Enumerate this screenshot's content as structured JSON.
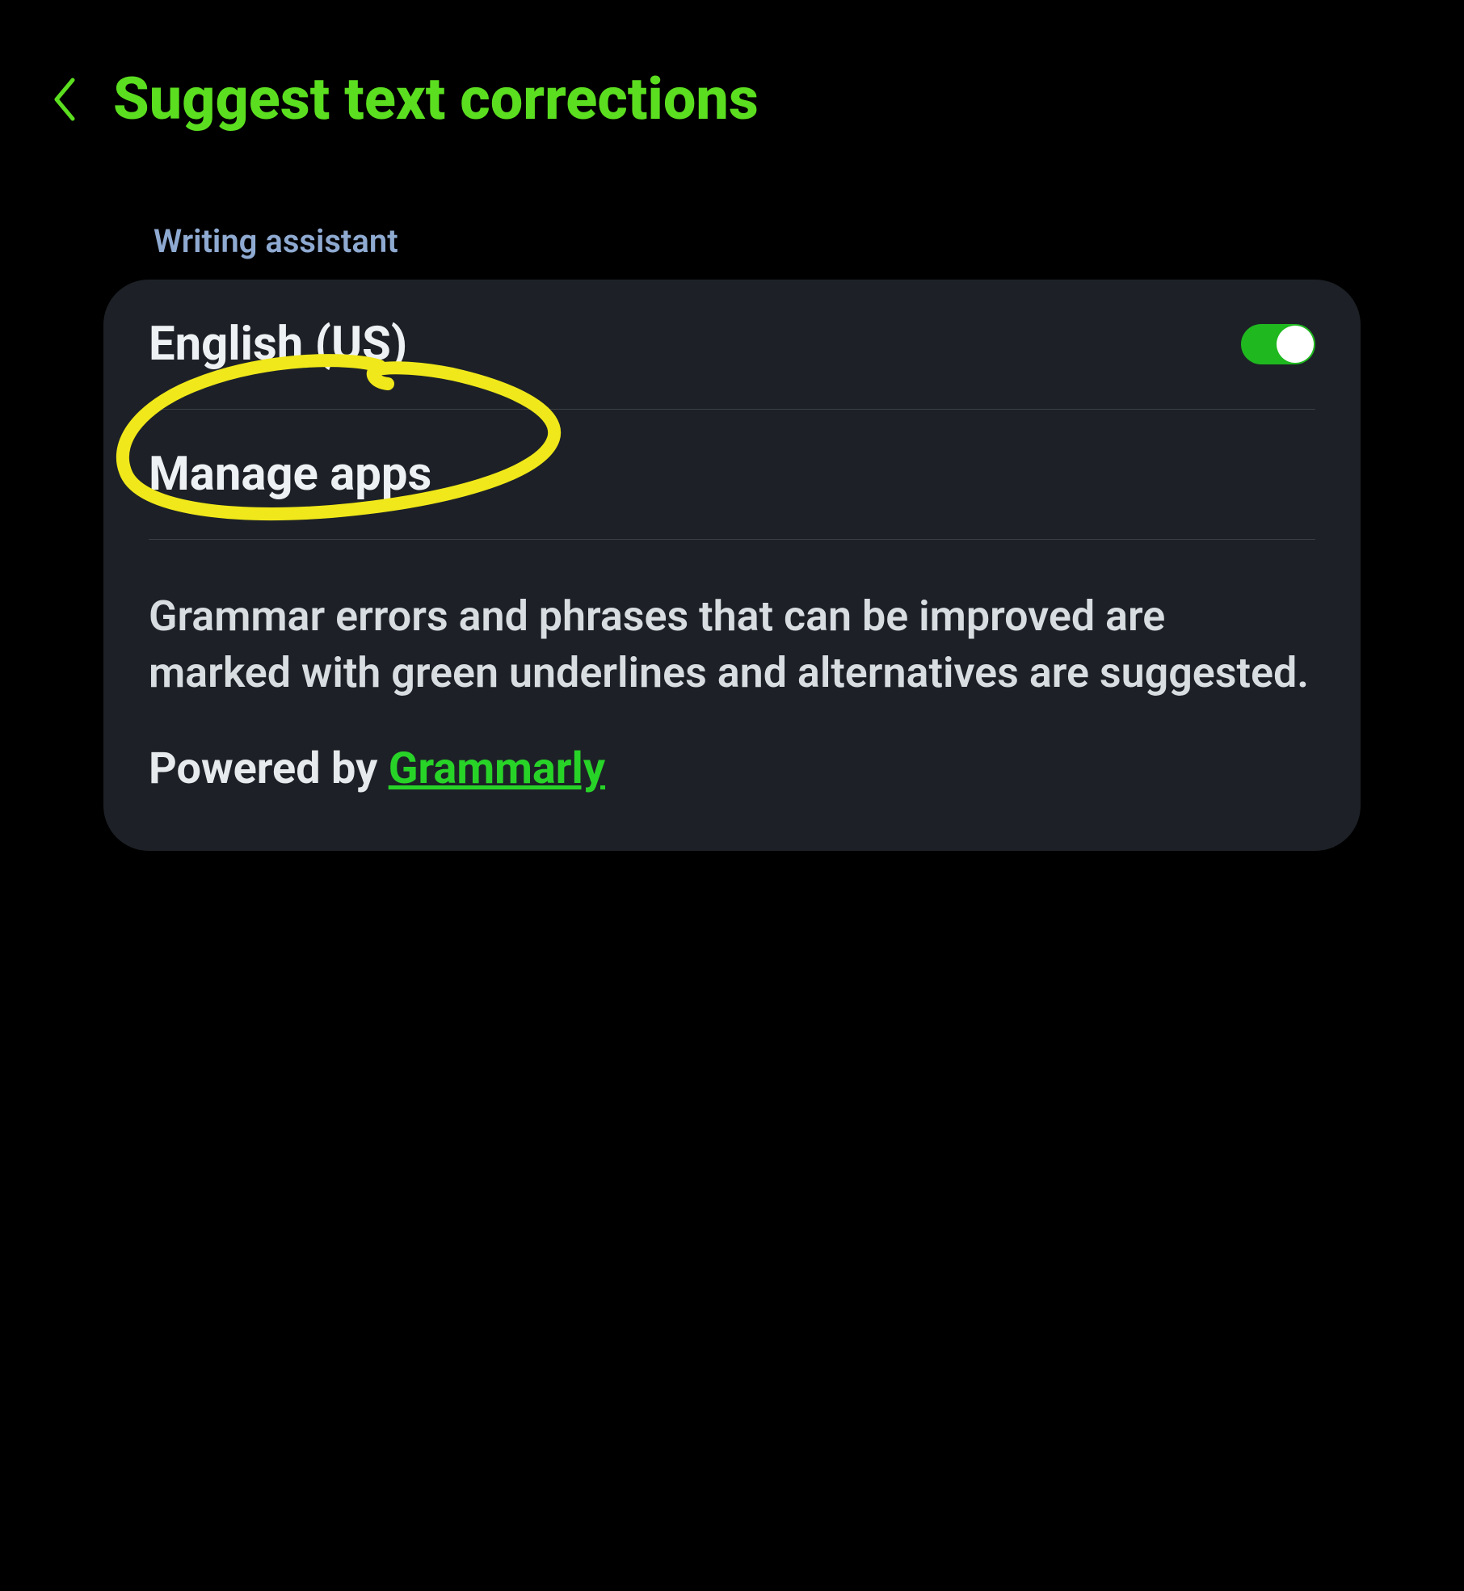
{
  "header": {
    "title": "Suggest text corrections"
  },
  "section_label": "Writing assistant",
  "rows": {
    "language": {
      "label": "English (US)",
      "toggle_on": true
    },
    "manage_apps": {
      "label": "Manage apps"
    }
  },
  "description": "Grammar errors and phrases that can be improved are marked with green underlines and alternatives are suggested.",
  "powered_by": {
    "prefix": "Powered by ",
    "link_text": "Grammarly"
  },
  "colors": {
    "accent_green": "#5bde1f",
    "toggle_green": "#1fb81f",
    "link_green": "#28d328",
    "section_blue": "#8faad1",
    "card_bg": "#1d2127",
    "annotation_yellow": "#f0e81a"
  }
}
